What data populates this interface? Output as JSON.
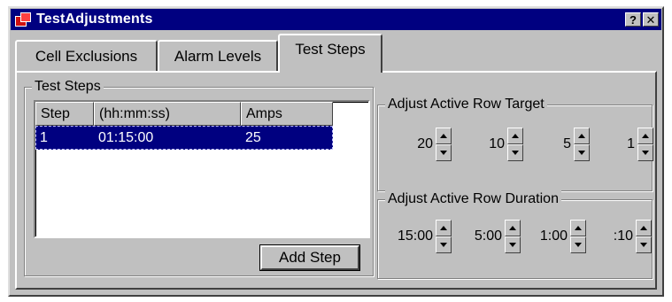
{
  "window": {
    "title": "TestAdjustments",
    "help_label": "?",
    "close_label": "✕"
  },
  "tabs": [
    {
      "label": "Cell Exclusions",
      "active": false
    },
    {
      "label": "Alarm Levels",
      "active": false
    },
    {
      "label": "Test Steps",
      "active": true
    }
  ],
  "test_steps": {
    "group_label": "Test Steps",
    "columns": [
      "Step",
      "(hh:mm:ss)",
      "Amps"
    ],
    "rows": [
      {
        "step": "1",
        "time": "01:15:00",
        "amps": "25",
        "selected": true
      }
    ],
    "add_step_label": "Add Step"
  },
  "target_group": {
    "label": "Adjust Active Row Target",
    "items": [
      "20",
      "10",
      "5",
      "1"
    ]
  },
  "duration_group": {
    "label": "Adjust Active Row Duration",
    "items": [
      "15:00",
      "5:00",
      "1:00",
      ":10"
    ]
  },
  "colors": {
    "titlebar": "#000080",
    "face": "#c0c0c0",
    "selection": "#000080"
  }
}
